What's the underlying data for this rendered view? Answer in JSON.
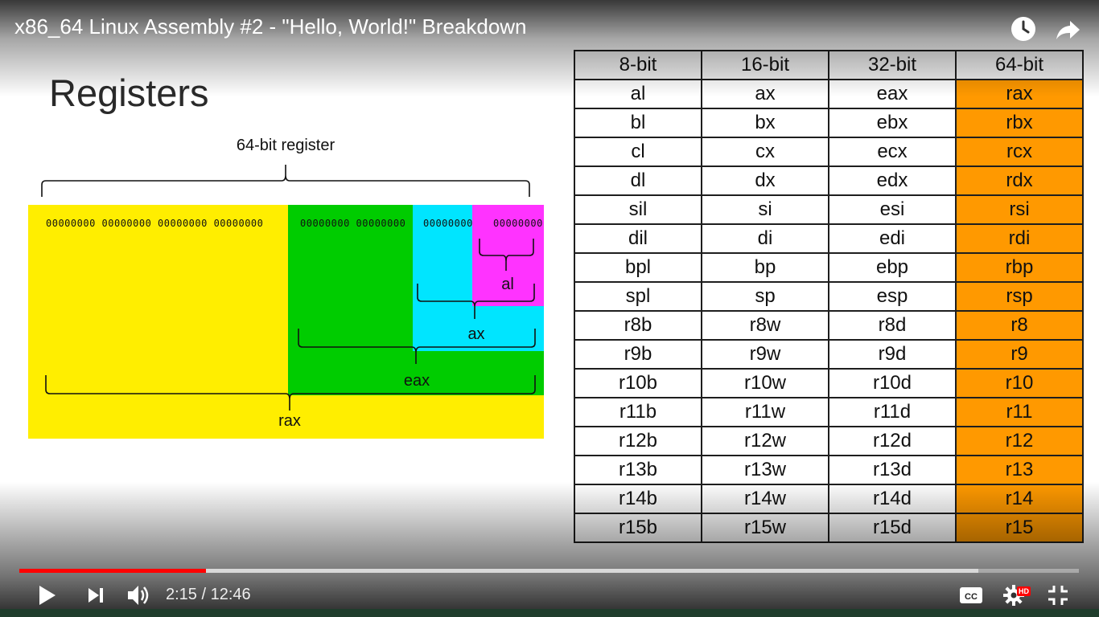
{
  "video": {
    "title": "x86_64 Linux Assembly #2 - \"Hello, World!\" Breakdown",
    "current_time": "2:15",
    "duration": "12:46",
    "time_display": "2:15 / 12:46",
    "progress_fraction": 0.176,
    "buffered_fraction": 0.905,
    "quality_badge": "HD",
    "icons": {
      "watch_later": "clock-icon",
      "share": "share-arrow-icon",
      "play": "play-icon",
      "next": "skip-next-icon",
      "volume": "volume-icon",
      "captions": "cc-icon",
      "settings": "gear-icon",
      "exit_fullscreen": "exit-fullscreen-icon"
    }
  },
  "slide": {
    "heading": "Registers",
    "diagram": {
      "top_label": "64-bit register",
      "bit_groups": [
        "00000000 00000000 00000000 00000000",
        "00000000 00000000",
        "00000000",
        "00000000"
      ],
      "labels": {
        "al": "al",
        "ax": "ax",
        "eax": "eax",
        "rax": "rax"
      },
      "colors": {
        "rax": "#ffee00",
        "eax": "#00cc00",
        "ax": "#00e5ff",
        "al": "#ff33ff"
      }
    },
    "table": {
      "headers": [
        "8-bit",
        "16-bit",
        "32-bit",
        "64-bit"
      ],
      "highlight_color": "#ff9900",
      "rows": [
        [
          "al",
          "ax",
          "eax",
          "rax"
        ],
        [
          "bl",
          "bx",
          "ebx",
          "rbx"
        ],
        [
          "cl",
          "cx",
          "ecx",
          "rcx"
        ],
        [
          "dl",
          "dx",
          "edx",
          "rdx"
        ],
        [
          "sil",
          "si",
          "esi",
          "rsi"
        ],
        [
          "dil",
          "di",
          "edi",
          "rdi"
        ],
        [
          "bpl",
          "bp",
          "ebp",
          "rbp"
        ],
        [
          "spl",
          "sp",
          "esp",
          "rsp"
        ],
        [
          "r8b",
          "r8w",
          "r8d",
          "r8"
        ],
        [
          "r9b",
          "r9w",
          "r9d",
          "r9"
        ],
        [
          "r10b",
          "r10w",
          "r10d",
          "r10"
        ],
        [
          "r11b",
          "r11w",
          "r11d",
          "r11"
        ],
        [
          "r12b",
          "r12w",
          "r12d",
          "r12"
        ],
        [
          "r13b",
          "r13w",
          "r13d",
          "r13"
        ],
        [
          "r14b",
          "r14w",
          "r14d",
          "r14"
        ],
        [
          "r15b",
          "r15w",
          "r15d",
          "r15"
        ]
      ]
    }
  }
}
